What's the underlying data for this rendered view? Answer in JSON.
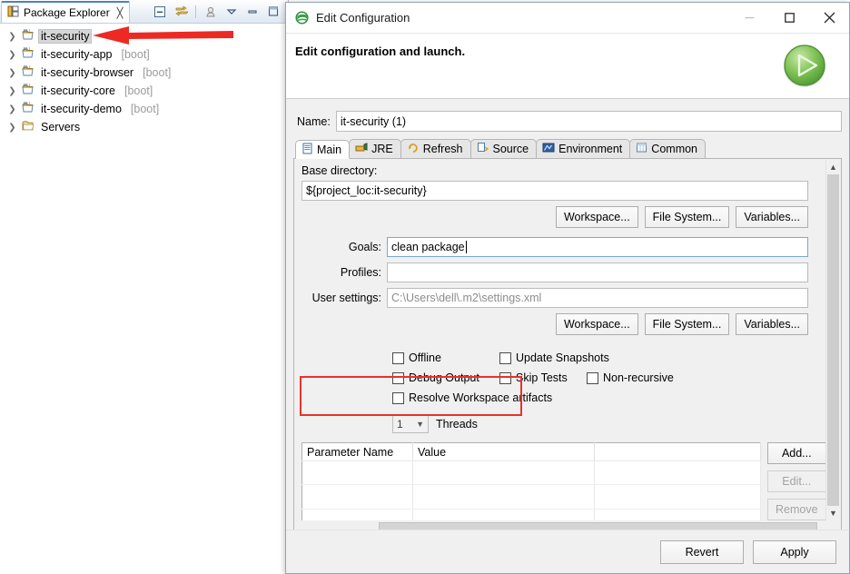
{
  "workbench": {
    "view_tab": {
      "title": "Package Explorer",
      "close_icon": "close-x-icon"
    },
    "toolbar": [
      {
        "name": "collapse-all-icon",
        "label": "Collapse All"
      },
      {
        "name": "link-with-editor-icon",
        "label": "Link with Editor"
      },
      {
        "name": "focus-on-active-task-icon",
        "label": "Focus on Active Task"
      },
      {
        "name": "view-menu-icon",
        "label": "View Menu"
      },
      {
        "name": "minimize-icon",
        "label": "Minimize"
      },
      {
        "name": "maximize-icon",
        "label": "Maximize"
      }
    ],
    "tree": [
      {
        "label": "it-security",
        "suffix": "",
        "icon": "maven-project-icon",
        "selected": true
      },
      {
        "label": "it-security-app",
        "suffix": "[boot]",
        "icon": "maven-project-icon",
        "selected": false
      },
      {
        "label": "it-security-browser",
        "suffix": "[boot]",
        "icon": "maven-project-icon",
        "selected": false
      },
      {
        "label": "it-security-core",
        "suffix": "[boot]",
        "icon": "maven-project-icon",
        "selected": false
      },
      {
        "label": "it-security-demo",
        "suffix": "[boot]",
        "icon": "maven-project-icon",
        "selected": false
      },
      {
        "label": "Servers",
        "suffix": "",
        "icon": "folder-icon",
        "selected": false
      }
    ],
    "annotation": {
      "name": "red-arrow-annotation",
      "color": "#e8322b"
    }
  },
  "dialog": {
    "title": "Edit Configuration",
    "title_icon": "eclipse-icon",
    "header_message": "Edit configuration and launch.",
    "run_badge_icon": "run-green-play-icon",
    "window_buttons": [
      {
        "name": "minimize-button",
        "glyph": "minimize-icon",
        "disabled": true
      },
      {
        "name": "maximize-button",
        "glyph": "maximize-icon",
        "disabled": false
      },
      {
        "name": "close-button",
        "glyph": "close-icon",
        "disabled": false
      }
    ],
    "name_field": {
      "label": "Name:",
      "value": "it-security (1)",
      "placeholder": ""
    },
    "tabs": [
      {
        "label": "Main",
        "icon": "main-tab-icon",
        "active": true
      },
      {
        "label": "JRE",
        "icon": "jre-tab-icon",
        "active": false
      },
      {
        "label": "Refresh",
        "icon": "refresh-tab-icon",
        "active": false
      },
      {
        "label": "Source",
        "icon": "source-tab-icon",
        "active": false
      },
      {
        "label": "Environment",
        "icon": "environment-tab-icon",
        "active": false
      },
      {
        "label": "Common",
        "icon": "common-tab-icon",
        "active": false
      }
    ],
    "main_tab": {
      "base_directory_label": "Base directory:",
      "base_directory_value": "${project_loc:it-security}",
      "browse_buttons_top": [
        {
          "label": "Workspace...",
          "name": "base-dir-workspace-button"
        },
        {
          "label": "File System...",
          "name": "base-dir-file-system-button"
        },
        {
          "label": "Variables...",
          "name": "base-dir-variables-button"
        }
      ],
      "goals": {
        "label": "Goals:",
        "value": "clean package",
        "focused": true,
        "highlighted": true
      },
      "profiles": {
        "label": "Profiles:",
        "value": ""
      },
      "user_settings": {
        "label": "User settings:",
        "value": "C:\\Users\\dell\\.m2\\settings.xml",
        "greyed": true
      },
      "browse_buttons_bottom": [
        {
          "label": "Workspace...",
          "name": "user-settings-workspace-button"
        },
        {
          "label": "File System...",
          "name": "user-settings-file-system-button"
        },
        {
          "label": "Variables...",
          "name": "user-settings-variables-button"
        }
      ],
      "checkboxes": [
        [
          {
            "label": "Offline",
            "checked": false
          },
          {
            "label": "Update Snapshots",
            "checked": false
          }
        ],
        [
          {
            "label": "Debug Output",
            "checked": false
          },
          {
            "label": "Skip Tests",
            "checked": false
          },
          {
            "label": "Non-recursive",
            "checked": false
          }
        ],
        [
          {
            "label": "Resolve Workspace artifacts",
            "checked": false
          }
        ]
      ],
      "threads": {
        "value": "1",
        "label": "Threads"
      },
      "parameters_table": {
        "columns": [
          "Parameter Name",
          "Value",
          ""
        ],
        "rows": []
      },
      "table_buttons": [
        {
          "label": "Add...",
          "name": "add-parameter-button",
          "disabled": false
        },
        {
          "label": "Edit...",
          "name": "edit-parameter-button",
          "disabled": true
        },
        {
          "label": "Remove",
          "name": "remove-parameter-button",
          "disabled": true
        }
      ]
    },
    "footer_buttons": [
      {
        "label": "Revert",
        "name": "revert-button",
        "disabled": false
      },
      {
        "label": "Apply",
        "name": "apply-button",
        "disabled": false
      }
    ]
  }
}
